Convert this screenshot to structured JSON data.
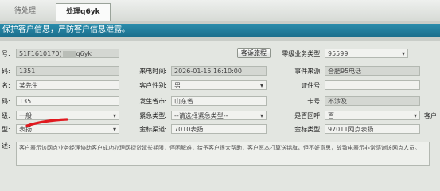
{
  "tabs": [
    {
      "label": "待处理"
    },
    {
      "label": "处理q6yk"
    }
  ],
  "banner": {
    "text": "保护客户信息，严防客户信息泄露。"
  },
  "form": {
    "row1": {
      "label_left": "号:",
      "value_left": "51F1610170(",
      "value_left_tail": "q6yk",
      "complaint_button": "客诉旅程",
      "label_right": "零级业务类型:",
      "value_right": "95599"
    },
    "row2": {
      "label_left": "码:",
      "value_left": "1351",
      "label_mid": "来电时间:",
      "value_mid": "2026-01-15 16:10:00",
      "label_right": "事件来源:",
      "value_right": "合肥95电话"
    },
    "row3": {
      "label_left": "名:",
      "value_left": "某先生",
      "label_mid": "客户性别:",
      "value_mid": "男",
      "label_right": "证件号:",
      "value_right": ""
    },
    "row4": {
      "label_left": "码:",
      "value_left": "135",
      "label_mid": "发生省市:",
      "value_mid": "山东省",
      "label_right": "卡号:",
      "value_right": "不涉及"
    },
    "row5": {
      "label_left": "级:",
      "value_left": "一般",
      "label_mid": "紧急类型:",
      "value_mid": "--请选择紧急类型--",
      "label_right": "是否回呼:",
      "value_right": "否",
      "label_far": "客户"
    },
    "row6": {
      "label_left": "型:",
      "value_left": "表扬",
      "label_mid": "金标渠道:",
      "value_mid": "7010表扬",
      "label_right": "金标类型:",
      "value_right": "97011网点表扬"
    },
    "description": {
      "label": "述:",
      "text": "客户表示该网点业务经理协助客户成功办理网捷贷延长期限，停困解难，给予客户很大帮助，客户愿本打算送锦旗，但不好意思，故致电表示非常感谢该网点人员。"
    }
  },
  "colors": {
    "banner": "#1c7c9c",
    "annotation_mark": "#e0191f"
  },
  "icons": {
    "dropdown": "chevron-down-icon"
  }
}
